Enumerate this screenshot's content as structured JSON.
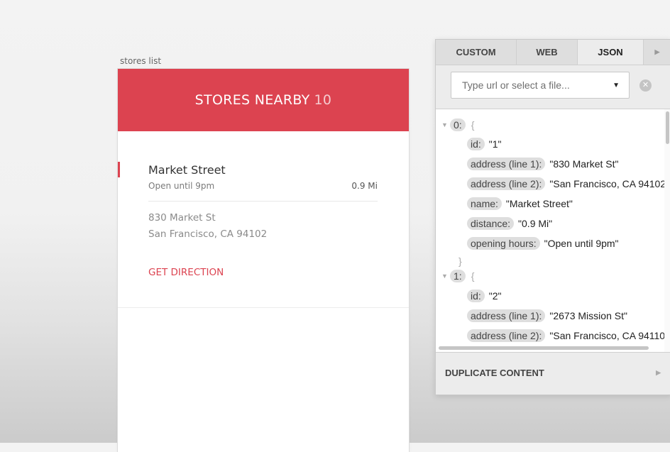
{
  "frame": {
    "label": "stores list"
  },
  "header": {
    "title": "STORES NEARBY",
    "count": "10"
  },
  "store": {
    "name": "Market Street",
    "hours": "Open until 9pm",
    "distance": "0.9 Mi",
    "address_line1": "830 Market St",
    "address_line2": "San Francisco, CA 94102",
    "direction_label": "GET DIRECTION"
  },
  "panel": {
    "tabs": [
      "CUSTOM",
      "WEB",
      "JSON"
    ],
    "active_tab": "JSON",
    "url_placeholder": "Type url or select a file...",
    "json_lines": [
      {
        "key": "0:",
        "value": "{"
      },
      {
        "key": "id:",
        "value": "\"1\""
      },
      {
        "key": "address (line 1):",
        "value": "\"830 Market St\""
      },
      {
        "key": "address (line 2):",
        "value": "\"San Francisco, CA 94102\""
      },
      {
        "key": "name:",
        "value": "\"Market Street\""
      },
      {
        "key": "distance:",
        "value": "\"0.9 Mi\""
      },
      {
        "key": "opening hours:",
        "value": "\"Open until 9pm\""
      },
      {
        "value": "}"
      },
      {
        "key": "1:",
        "value": "{"
      },
      {
        "key": "id:",
        "value": "\"2\""
      },
      {
        "key": "address (line 1):",
        "value": "\"2673 Mission St\""
      },
      {
        "key": "address (line 2):",
        "value": "\"San Francisco, CA 94110\""
      }
    ],
    "duplicate_label": "DUPLICATE CONTENT"
  },
  "colors": {
    "accent": "#dc4350"
  }
}
